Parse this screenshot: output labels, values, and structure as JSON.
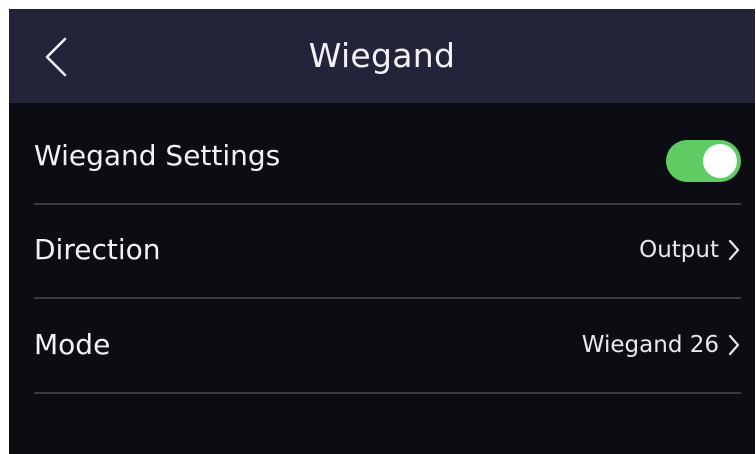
{
  "header": {
    "title": "Wiegand",
    "back_icon": "chevron-left-icon"
  },
  "settings": {
    "wiegand_settings": {
      "label": "Wiegand Settings",
      "enabled": true,
      "toggle_color": "#5fcb62"
    },
    "direction": {
      "label": "Direction",
      "value": "Output",
      "icon": "chevron-right-icon"
    },
    "mode": {
      "label": "Mode",
      "value": "Wiegand 26",
      "icon": "chevron-right-icon"
    }
  },
  "colors": {
    "header_bg": "#23233a",
    "background": "#0c0d12",
    "divider": "#3a3a42",
    "text": "#f2f2f5"
  }
}
